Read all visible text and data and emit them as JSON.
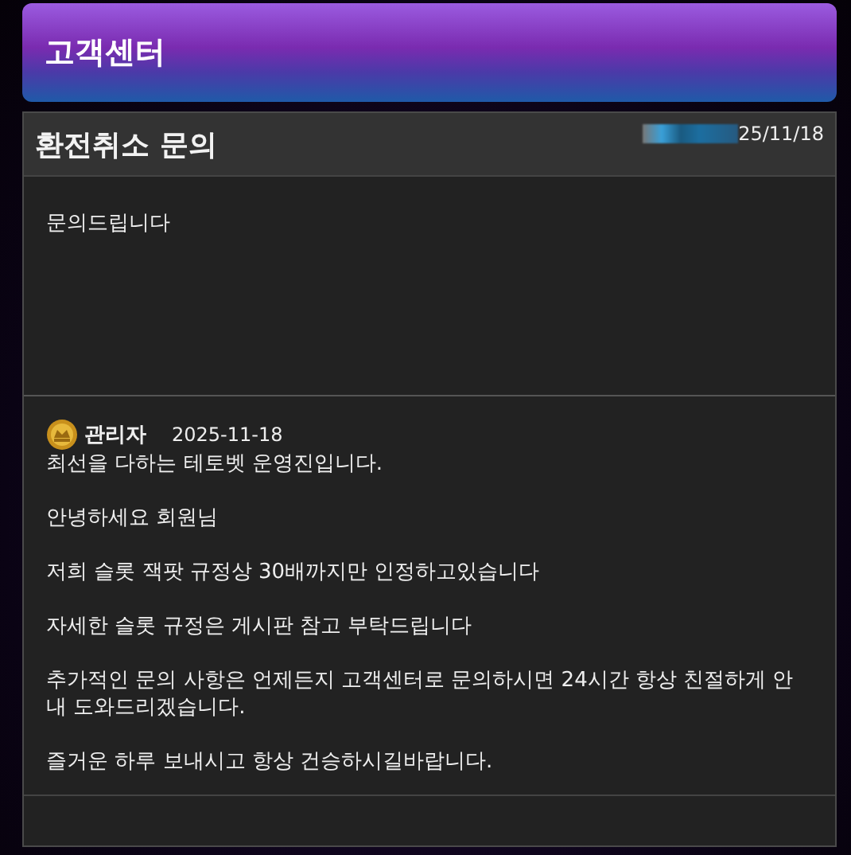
{
  "header": {
    "title": "고객센터"
  },
  "post": {
    "title": "환전취소 문의",
    "date": "25/11/18",
    "redacted": true,
    "body": "문의드립니다"
  },
  "reply": {
    "author": "관리자",
    "date": "2025-11-18",
    "paragraphs": [
      "최선을 다하는 테토벳 운영진입니다.",
      "안녕하세요 회원님",
      "저희 슬롯 잭팟 규정상 30배까지만 인정하고있습니다",
      "자세한 슬롯 규정은 게시판 참고 부탁드립니다",
      "추가적인 문의 사항은 언제든지 고객센터로 문의하시면 24시간 항상 친절하게 안내 도와드리겠습니다.",
      "즐거운 하루 보내시고 항상 건승하시길바랍니다."
    ]
  }
}
